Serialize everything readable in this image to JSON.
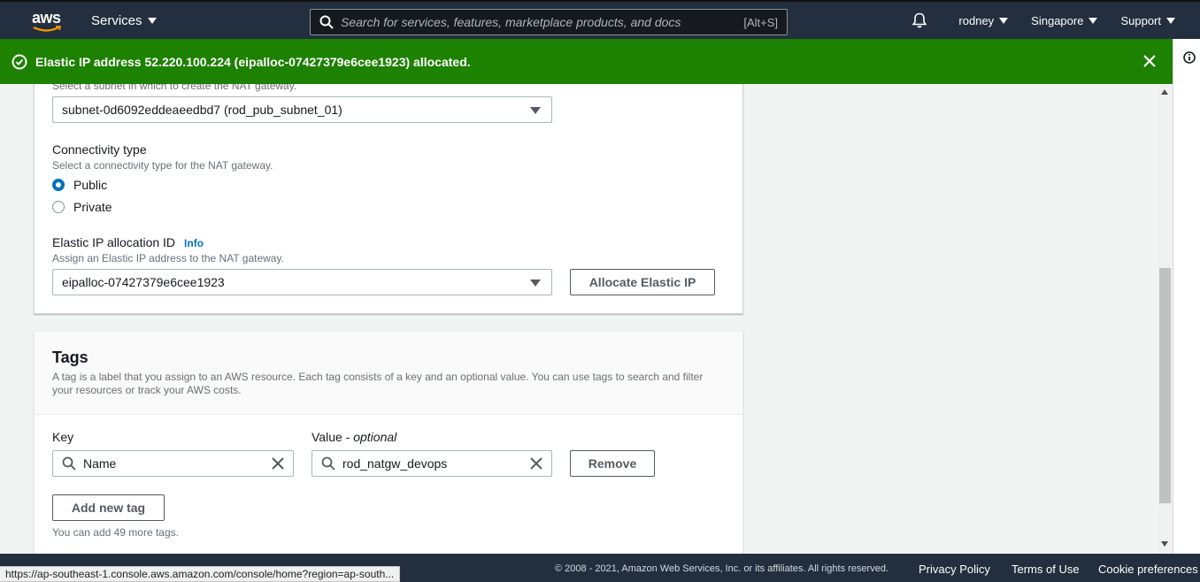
{
  "nav": {
    "logo": "aws",
    "services": "Services",
    "search_placeholder": "Search for services, features, marketplace products, and docs",
    "search_shortcut": "[Alt+S]",
    "user": "rodney",
    "region": "Singapore",
    "support": "Support"
  },
  "flash": {
    "message": "Elastic IP address 52.220.100.224 (eipalloc-07427379e6cee1923) allocated.",
    "color": "#1d8102"
  },
  "nat": {
    "subnet_hint": "Select a subnet in which to create the NAT gateway.",
    "subnet_value": "subnet-0d6092eddeaeedbd7 (rod_pub_subnet_01)",
    "connectivity_label": "Connectivity type",
    "connectivity_hint": "Select a connectivity type for the NAT gateway.",
    "option_public": "Public",
    "option_private": "Private",
    "eip_label": "Elastic IP allocation ID",
    "eip_info": "Info",
    "eip_hint": "Assign an Elastic IP address to the NAT gateway.",
    "eip_value": "eipalloc-07427379e6cee1923",
    "allocate_button": "Allocate Elastic IP"
  },
  "tags": {
    "title": "Tags",
    "description": "A tag is a label that you assign to an AWS resource. Each tag consists of a key and an optional value. You can use tags to search and filter your resources or track your AWS costs.",
    "key_label": "Key",
    "value_label": "Value - ",
    "value_optional": "optional",
    "key_value": "Name",
    "value_value": "rod_natgw_devops",
    "remove_button": "Remove",
    "add_button": "Add new tag",
    "remaining": "You can add 49 more tags."
  },
  "footer": {
    "copyright": "© 2008 - 2021, Amazon Web Services, Inc. or its affiliates. All rights reserved.",
    "privacy": "Privacy Policy",
    "terms": "Terms of Use",
    "cookies": "Cookie preferences",
    "status_url": "https://ap-southeast-1.console.aws.amazon.com/console/home?region=ap-south..."
  },
  "colors": {
    "nav_bg": "#232f3e",
    "accent": "#0073bb",
    "smile": "#ff9900"
  }
}
